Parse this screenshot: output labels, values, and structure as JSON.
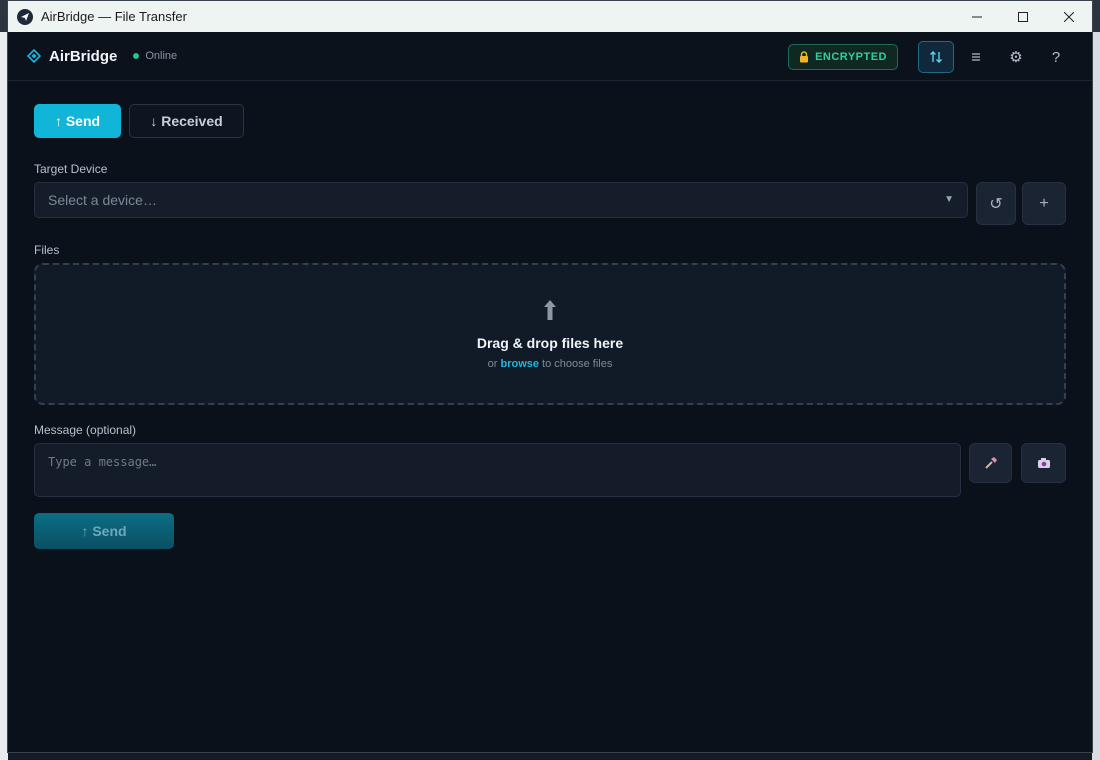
{
  "window": {
    "title": "AirBridge — File Transfer"
  },
  "header": {
    "brand": "AirBridge",
    "status": "Online",
    "badge": "ENCRYPTED"
  },
  "tabs": [
    {
      "label": "↑ Send",
      "active": true
    },
    {
      "label": "↓ Received",
      "active": false
    }
  ],
  "target": {
    "label": "Target Device",
    "placeholder": "Select a device…"
  },
  "files": {
    "label": "Files",
    "title": "Drag & drop files here",
    "sub_prefix": "or ",
    "browse": "browse",
    "sub_suffix": " to choose files"
  },
  "message": {
    "label": "Message (optional)",
    "placeholder": "Type a message…"
  },
  "send_button": "↑ Send",
  "colors": {
    "accent": "#10b5d8",
    "online": "#24c28a",
    "encrypted": "#2fd19b",
    "background": "#0b111b"
  }
}
